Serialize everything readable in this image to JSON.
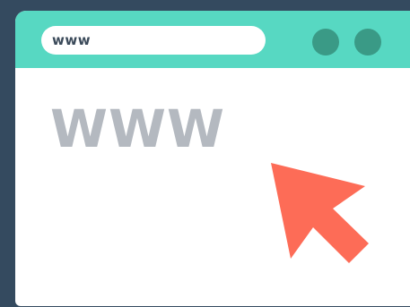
{
  "address_bar": {
    "url_text": "www"
  },
  "content": {
    "heading": "WWW"
  },
  "colors": {
    "background": "#344a5f",
    "title_bar": "#57d8c2",
    "window_buttons": "#3a9a86",
    "heading_text": "#b4b9c0",
    "cursor": "#fd6c57"
  },
  "icons": {
    "cursor": "arrow-cursor-icon"
  }
}
